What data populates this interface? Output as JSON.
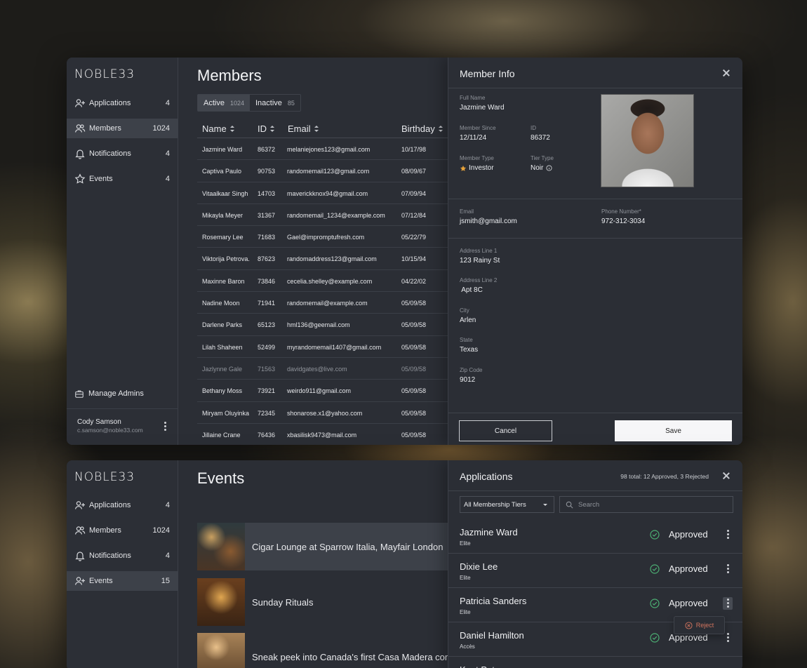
{
  "colors": {
    "accent_approved": "#4caf73",
    "reject": "#d2745e",
    "star": "#e8a33a"
  },
  "sidebar": {
    "logo": "NOBLE33",
    "items": [
      {
        "icon": "add-user-icon",
        "label": "Applications",
        "count": "4"
      },
      {
        "icon": "members-icon",
        "label": "Members",
        "count": "1024"
      },
      {
        "icon": "bell-icon",
        "label": "Notifications",
        "count": "4"
      },
      {
        "icon": "star-icon",
        "label": "Events",
        "count": "4"
      }
    ],
    "items2": [
      {
        "icon": "add-user-icon",
        "label": "Applications",
        "count": "4"
      },
      {
        "icon": "members-icon",
        "label": "Members",
        "count": "1024"
      },
      {
        "icon": "bell-icon",
        "label": "Notifications",
        "count": "4"
      },
      {
        "icon": "add-user-icon",
        "label": "Events",
        "count": "15"
      }
    ],
    "manage_admins": "Manage Admins",
    "user": {
      "name": "Cody Samson",
      "email": "c.samson@noble33.com"
    }
  },
  "members": {
    "title": "Members",
    "tabs": [
      {
        "label": "Active",
        "count": "1024"
      },
      {
        "label": "Inactive",
        "count": "85"
      }
    ],
    "columns": [
      "Name",
      "ID",
      "Email",
      "Birthday"
    ],
    "rows": [
      [
        "Jazmine Ward",
        "86372",
        "melaniejones123@gmail.com",
        "10/17/98"
      ],
      [
        "Captiva Paulo",
        "90753",
        "randomemail123@gmail.com",
        "08/09/67"
      ],
      [
        "Vitaalkaar Singh",
        "14703",
        "maverickknox94@gmail.com",
        "07/09/94"
      ],
      [
        "Mikayla Meyer",
        "31367",
        "randomemail_1234@example.com",
        "07/12/84"
      ],
      [
        "Rosemary Lee",
        "71683",
        "Gael@impromptufresh.com",
        "05/22/79"
      ],
      [
        "Viktorija Petrova.",
        "87623",
        "randomaddress123@gmail.com",
        "10/15/94"
      ],
      [
        "Maxinne Baron",
        "73846",
        "cecelia.shelley@example.com",
        "04/22/02"
      ],
      [
        "Nadine Moon",
        "71941",
        "randomemail@example.com",
        "05/09/58"
      ],
      [
        "Darlene Parks",
        "65123",
        "hml136@geemail.com",
        "05/09/58"
      ],
      [
        "Lilah Shaheen",
        "52499",
        "myrandomemail1407@gmail.com",
        "05/09/58"
      ],
      [
        "Jazlynne Gale",
        "71563",
        "davidgates@live.com",
        "05/09/58"
      ],
      [
        "Bethany Moss",
        "73921",
        "weirdo911@gmail.com",
        "05/09/58"
      ],
      [
        "Miryam Oluyinka",
        "72345",
        "shonarose.x1@yahoo.com",
        "05/09/58"
      ],
      [
        "Jillaine Crane",
        "76436",
        "xbasilisk9473@mail.com",
        "05/09/58"
      ]
    ]
  },
  "member_info": {
    "title": "Member Info",
    "full_name_label": "Full Name",
    "full_name": "Jazmine Ward",
    "since_label": "Member Since",
    "since": "12/11/24",
    "id_label": "ID",
    "id": "86372",
    "type_label": "Member Type",
    "type": "Investor",
    "tier_label": "Tier Type",
    "tier": "Noir",
    "email_label": "Email",
    "email": "jsmith@gmail.com",
    "phone_label": "Phone Number*",
    "phone": "972-312-3034",
    "addr1_label": "Address Line 1",
    "addr1": "123 Rainy St",
    "addr2_label": "Address Line 2",
    "addr2": " Apt 8C",
    "city_label": "City",
    "city": "Arlen",
    "state_label": "State",
    "state": "Texas",
    "zip_label": "Zip Code",
    "zip": "9012",
    "cancel": "Cancel",
    "save": "Save"
  },
  "events": {
    "title": "Events",
    "items": [
      {
        "title": "Cigar Lounge at Sparrow Italia, Mayfair London"
      },
      {
        "title": "Sunday Rituals"
      },
      {
        "title": "Sneak peek into Canada's first Casa Madera coming"
      }
    ]
  },
  "applications": {
    "title": "Applications",
    "summary": "98 total:  12 Approved, 3 Rejected",
    "filter": "All Membership Tiers",
    "search_placeholder": "Search",
    "items": [
      {
        "name": "Jazmine Ward",
        "tier": "Elite",
        "status": "Approved"
      },
      {
        "name": "Dixie Lee",
        "tier": "Elite",
        "status": "Approved"
      },
      {
        "name": "Patricia Sanders",
        "tier": "Elite",
        "status": "Approved"
      },
      {
        "name": "Daniel Hamilton",
        "tier": "Accès",
        "status": "Approved"
      },
      {
        "name": "Kent Peters",
        "tier": "",
        "status": ""
      }
    ],
    "reject": "Reject"
  }
}
